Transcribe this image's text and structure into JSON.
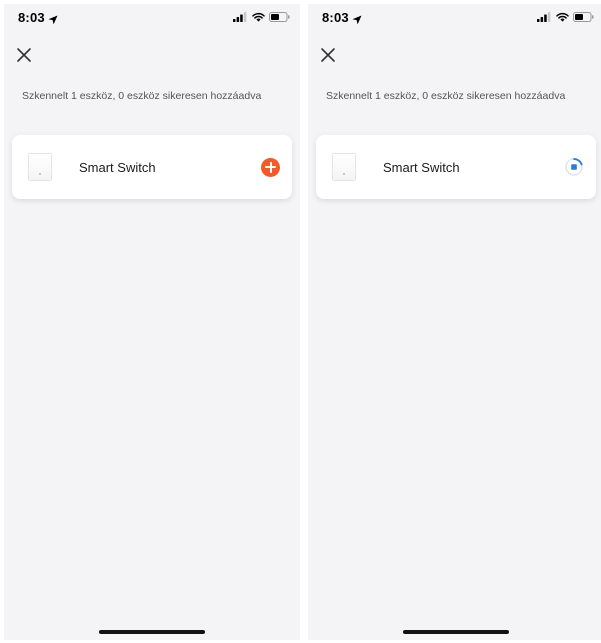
{
  "screens": [
    {
      "status": {
        "time": "8:03"
      },
      "close_icon": "close-icon",
      "scan_text": "Szkennelt 1 eszköz, 0 eszköz sikeresen hozzáadva",
      "device": {
        "name": "Smart Switch",
        "action": "add",
        "accent": "#f15a2b"
      }
    },
    {
      "status": {
        "time": "8:03"
      },
      "close_icon": "close-icon",
      "scan_text": "Szkennelt 1 eszköz, 0 eszköz sikeresen hozzáadva",
      "device": {
        "name": "Smart Switch",
        "action": "adding-progress",
        "accent": "#2f7ad8"
      }
    }
  ]
}
